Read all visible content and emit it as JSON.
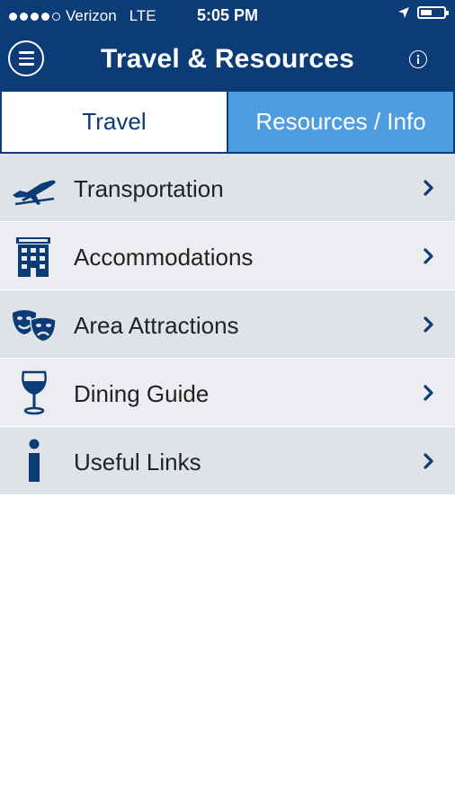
{
  "status_bar": {
    "carrier": "Verizon",
    "network": "LTE",
    "time": "5:05 PM"
  },
  "nav": {
    "title": "Travel & Resources",
    "menu_icon": "hamburger-icon",
    "info_icon": "info-icon"
  },
  "tabs": {
    "travel": "Travel",
    "resources": "Resources / Info",
    "active": "travel"
  },
  "menu": [
    {
      "label": "Transportation",
      "icon": "airplane-icon"
    },
    {
      "label": "Accommodations",
      "icon": "hotel-icon"
    },
    {
      "label": "Area Attractions",
      "icon": "theater-masks-icon"
    },
    {
      "label": "Dining Guide",
      "icon": "wine-glass-icon"
    },
    {
      "label": "Useful Links",
      "icon": "info-icon"
    }
  ],
  "colors": {
    "header": "#0c3c78",
    "tab_active_text": "#0c3c78",
    "tab_inactive_bg": "#4d9de0",
    "row_odd": "#dfe3e7",
    "row_even": "#ebedf0"
  }
}
